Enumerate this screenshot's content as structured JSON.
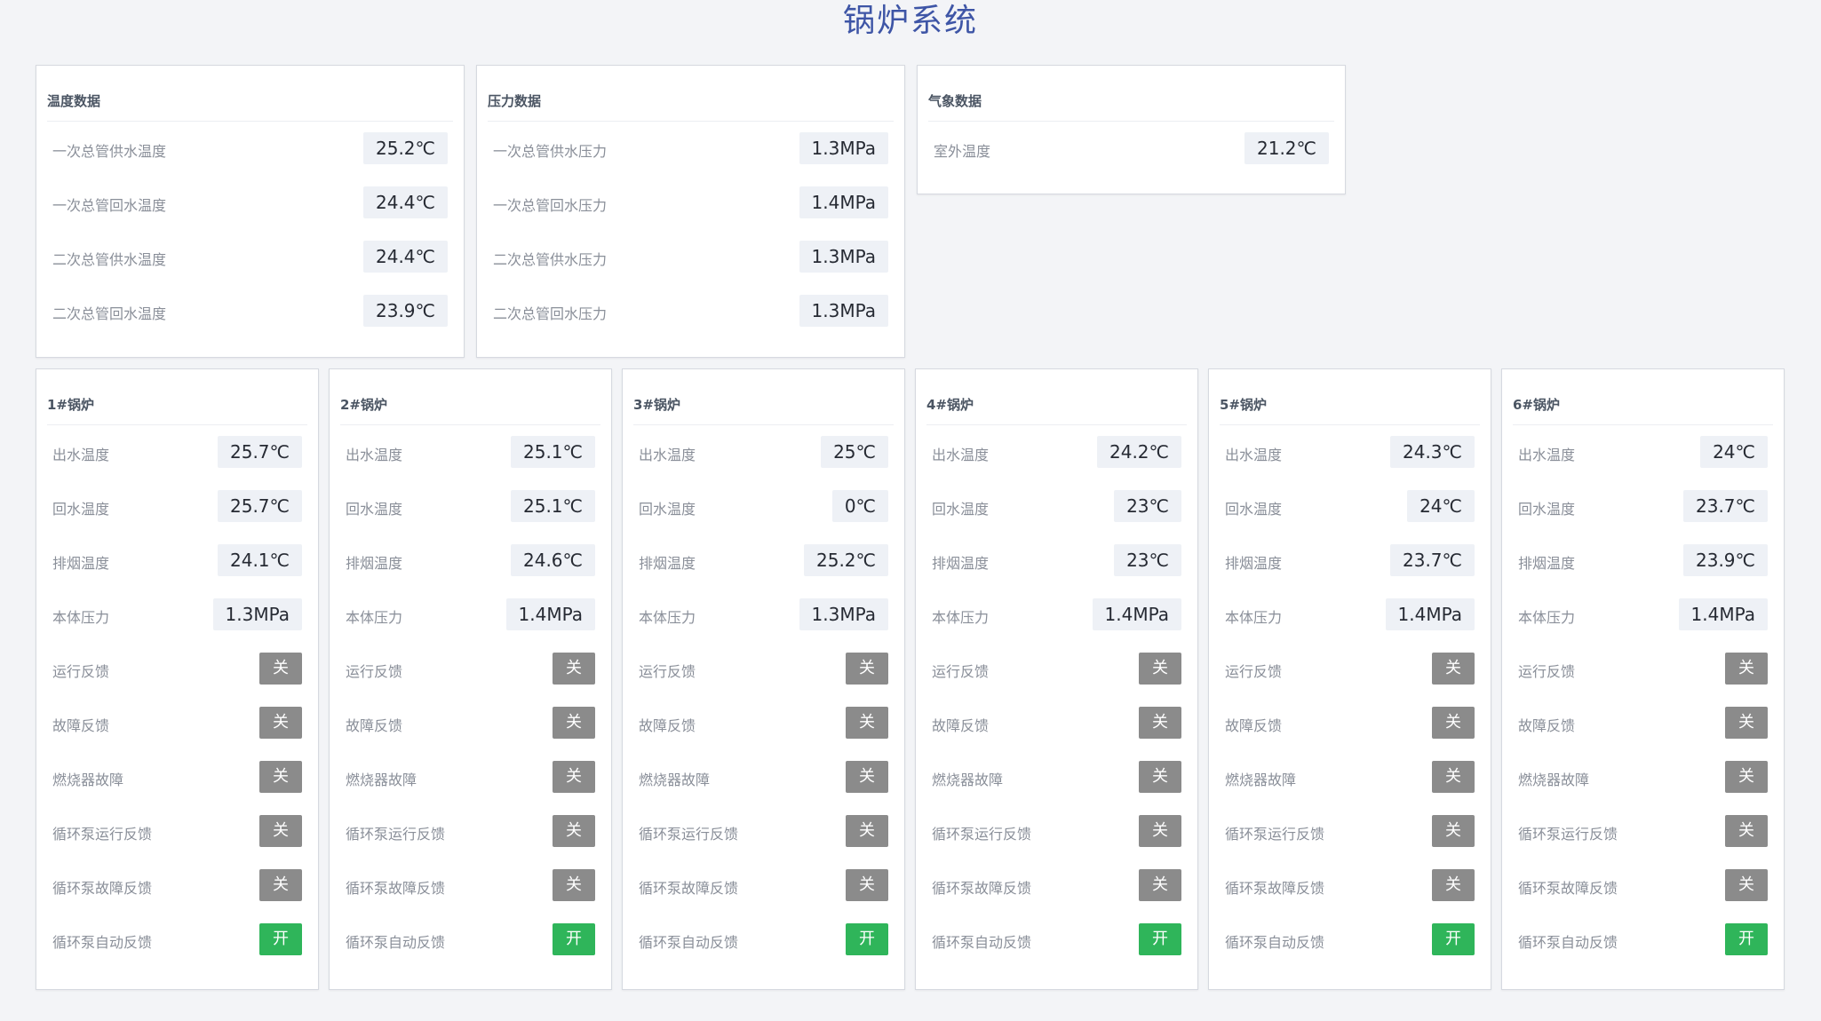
{
  "title": "锅炉系统",
  "colors": {
    "accent": "#3e55a6",
    "status_on": "#2fb55a",
    "status_off": "#8b8b8b"
  },
  "summary_panels": [
    {
      "title": "温度数据",
      "rows": [
        {
          "label": "一次总管供水温度",
          "value": "25.2℃"
        },
        {
          "label": "一次总管回水温度",
          "value": "24.4℃"
        },
        {
          "label": "二次总管供水温度",
          "value": "24.4℃"
        },
        {
          "label": "二次总管回水温度",
          "value": "23.9℃"
        }
      ]
    },
    {
      "title": "压力数据",
      "rows": [
        {
          "label": "一次总管供水压力",
          "value": "1.3MPa"
        },
        {
          "label": "一次总管回水压力",
          "value": "1.4MPa"
        },
        {
          "label": "二次总管供水压力",
          "value": "1.3MPa"
        },
        {
          "label": "二次总管回水压力",
          "value": "1.3MPa"
        }
      ]
    },
    {
      "title": "气象数据",
      "rows": [
        {
          "label": "室外温度",
          "value": "21.2℃"
        }
      ]
    }
  ],
  "boilers": [
    {
      "title": "1#锅炉",
      "metrics": [
        {
          "label": "出水温度",
          "value": "25.7℃"
        },
        {
          "label": "回水温度",
          "value": "25.7℃"
        },
        {
          "label": "排烟温度",
          "value": "24.1℃"
        },
        {
          "label": "本体压力",
          "value": "1.3MPa"
        }
      ],
      "statuses": [
        {
          "label": "运行反馈",
          "state": "关",
          "on": false
        },
        {
          "label": "故障反馈",
          "state": "关",
          "on": false
        },
        {
          "label": "燃烧器故障",
          "state": "关",
          "on": false
        },
        {
          "label": "循环泵运行反馈",
          "state": "关",
          "on": false
        },
        {
          "label": "循环泵故障反馈",
          "state": "关",
          "on": false
        },
        {
          "label": "循环泵自动反馈",
          "state": "开",
          "on": true
        }
      ]
    },
    {
      "title": "2#锅炉",
      "metrics": [
        {
          "label": "出水温度",
          "value": "25.1℃"
        },
        {
          "label": "回水温度",
          "value": "25.1℃"
        },
        {
          "label": "排烟温度",
          "value": "24.6℃"
        },
        {
          "label": "本体压力",
          "value": "1.4MPa"
        }
      ],
      "statuses": [
        {
          "label": "运行反馈",
          "state": "关",
          "on": false
        },
        {
          "label": "故障反馈",
          "state": "关",
          "on": false
        },
        {
          "label": "燃烧器故障",
          "state": "关",
          "on": false
        },
        {
          "label": "循环泵运行反馈",
          "state": "关",
          "on": false
        },
        {
          "label": "循环泵故障反馈",
          "state": "关",
          "on": false
        },
        {
          "label": "循环泵自动反馈",
          "state": "开",
          "on": true
        }
      ]
    },
    {
      "title": "3#锅炉",
      "metrics": [
        {
          "label": "出水温度",
          "value": "25℃"
        },
        {
          "label": "回水温度",
          "value": "0℃"
        },
        {
          "label": "排烟温度",
          "value": "25.2℃"
        },
        {
          "label": "本体压力",
          "value": "1.3MPa"
        }
      ],
      "statuses": [
        {
          "label": "运行反馈",
          "state": "关",
          "on": false
        },
        {
          "label": "故障反馈",
          "state": "关",
          "on": false
        },
        {
          "label": "燃烧器故障",
          "state": "关",
          "on": false
        },
        {
          "label": "循环泵运行反馈",
          "state": "关",
          "on": false
        },
        {
          "label": "循环泵故障反馈",
          "state": "关",
          "on": false
        },
        {
          "label": "循环泵自动反馈",
          "state": "开",
          "on": true
        }
      ]
    },
    {
      "title": "4#锅炉",
      "metrics": [
        {
          "label": "出水温度",
          "value": "24.2℃"
        },
        {
          "label": "回水温度",
          "value": "23℃"
        },
        {
          "label": "排烟温度",
          "value": "23℃"
        },
        {
          "label": "本体压力",
          "value": "1.4MPa"
        }
      ],
      "statuses": [
        {
          "label": "运行反馈",
          "state": "关",
          "on": false
        },
        {
          "label": "故障反馈",
          "state": "关",
          "on": false
        },
        {
          "label": "燃烧器故障",
          "state": "关",
          "on": false
        },
        {
          "label": "循环泵运行反馈",
          "state": "关",
          "on": false
        },
        {
          "label": "循环泵故障反馈",
          "state": "关",
          "on": false
        },
        {
          "label": "循环泵自动反馈",
          "state": "开",
          "on": true
        }
      ]
    },
    {
      "title": "5#锅炉",
      "metrics": [
        {
          "label": "出水温度",
          "value": "24.3℃"
        },
        {
          "label": "回水温度",
          "value": "24℃"
        },
        {
          "label": "排烟温度",
          "value": "23.7℃"
        },
        {
          "label": "本体压力",
          "value": "1.4MPa"
        }
      ],
      "statuses": [
        {
          "label": "运行反馈",
          "state": "关",
          "on": false
        },
        {
          "label": "故障反馈",
          "state": "关",
          "on": false
        },
        {
          "label": "燃烧器故障",
          "state": "关",
          "on": false
        },
        {
          "label": "循环泵运行反馈",
          "state": "关",
          "on": false
        },
        {
          "label": "循环泵故障反馈",
          "state": "关",
          "on": false
        },
        {
          "label": "循环泵自动反馈",
          "state": "开",
          "on": true
        }
      ]
    },
    {
      "title": "6#锅炉",
      "metrics": [
        {
          "label": "出水温度",
          "value": "24℃"
        },
        {
          "label": "回水温度",
          "value": "23.7℃"
        },
        {
          "label": "排烟温度",
          "value": "23.9℃"
        },
        {
          "label": "本体压力",
          "value": "1.4MPa"
        }
      ],
      "statuses": [
        {
          "label": "运行反馈",
          "state": "关",
          "on": false
        },
        {
          "label": "故障反馈",
          "state": "关",
          "on": false
        },
        {
          "label": "燃烧器故障",
          "state": "关",
          "on": false
        },
        {
          "label": "循环泵运行反馈",
          "state": "关",
          "on": false
        },
        {
          "label": "循环泵故障反馈",
          "state": "关",
          "on": false
        },
        {
          "label": "循环泵自动反馈",
          "state": "开",
          "on": true
        }
      ]
    }
  ]
}
